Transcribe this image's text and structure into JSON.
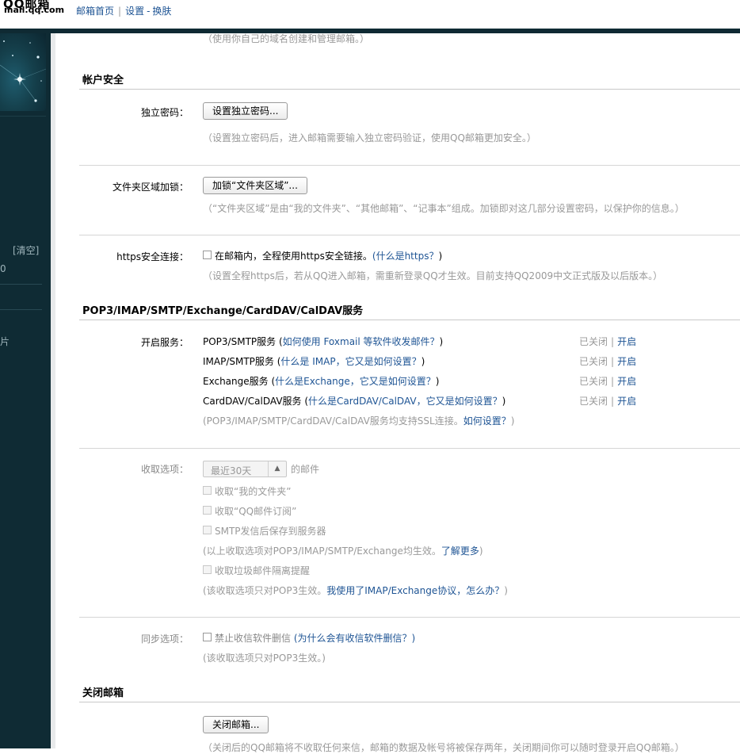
{
  "header": {
    "logo_text": "QQ邮箱",
    "logo_domain": "mail.qq.com",
    "nav": {
      "home": "邮箱首页",
      "settings": "设置",
      "dash": "-",
      "skin": "换肤"
    }
  },
  "sidebar": {
    "clear_label": "[清空]",
    "frag_1": "0",
    "frag_2": "片"
  },
  "main": {
    "top_hint": "（使用你自己的域名创建和管理邮箱。）",
    "account_security": {
      "title": "帐户安全",
      "independent_password": {
        "label": "独立密码：",
        "button": "设置独立密码...",
        "hint": "（设置独立密码后，进入邮箱需要输入独立密码验证，使用QQ邮箱更加安全。）"
      },
      "folder_lock": {
        "label": "文件夹区域加锁：",
        "button": "加锁“文件夹区域”...",
        "hint": "（“文件夹区域”是由“我的文件夹”、“其他邮箱”、“记事本”组成。加锁即对这几部分设置密码，以保护你的信息。）"
      },
      "https": {
        "label": "https安全连接：",
        "checkbox_text": "在邮箱内，全程使用https安全链接。",
        "link_open": "(",
        "link": "什么是https？",
        "link_close": ")",
        "hint": "（设置全程https后，若从QQ进入邮箱，需重新登录QQ才生效。目前支持QQ2009中文正式版及以后版本。）"
      }
    },
    "services": {
      "title": "POP3/IMAP/SMTP/Exchange/CardDAV/CalDAV服务",
      "label": "开启服务：",
      "items": [
        {
          "name": "POP3/SMTP服务 (",
          "link": "如何使用 Foxmail 等软件收发邮件？",
          "close": ")",
          "status": "已关闭",
          "sep": "|",
          "action": "开启"
        },
        {
          "name": "IMAP/SMTP服务 (",
          "link": "什么是 IMAP，它又是如何设置？",
          "close": ")",
          "status": "已关闭",
          "sep": "|",
          "action": "开启"
        },
        {
          "name": "Exchange服务 (",
          "link": "什么是Exchange，它又是如何设置？",
          "close": ")",
          "status": "已关闭",
          "sep": "|",
          "action": "开启"
        },
        {
          "name": "CardDAV/CalDAV服务 (",
          "link": "什么是CardDAV/CalDAV，它又是如何设置？",
          "close": ")",
          "status": "已关闭",
          "sep": "|",
          "action": "开启"
        }
      ],
      "ssl_hint": "(POP3/IMAP/SMTP/CardDAV/CalDAV服务均支持SSL连接。",
      "ssl_link": "如何设置？",
      "ssl_close": ")"
    },
    "receive_options": {
      "label": "收取选项：",
      "select_value": "最近30天",
      "select_suffix": "的邮件",
      "opt_my_folders": "收取“我的文件夹”",
      "opt_subscriptions": "收取“QQ邮件订阅”",
      "opt_smtp_save": "SMTP发信后保存到服务器",
      "note1": "(以上收取选项对POP3/IMAP/SMTP/Exchange均生效。",
      "note1_link": "了解更多",
      "note1_close": ")",
      "opt_spam": "收取垃圾邮件隔离提醒",
      "note2": "(该收取选项只对POP3生效。",
      "note2_link": "我使用了IMAP/Exchange协议，怎么办？",
      "note2_close": ")"
    },
    "sync_options": {
      "label": "同步选项：",
      "checkbox_text": "禁止收信软件删信",
      "link": "(为什么会有收信软件删信？)",
      "hint": "(该收取选项只对POP3生效。)"
    },
    "close_mailbox": {
      "title": "关闭邮箱",
      "button": "关闭邮箱...",
      "hint": "（关闭后的QQ邮箱将不收取任何来信，邮箱的数据及帐号将被保存两年，关闭期间你可以随时登录开启QQ邮箱。）"
    }
  }
}
